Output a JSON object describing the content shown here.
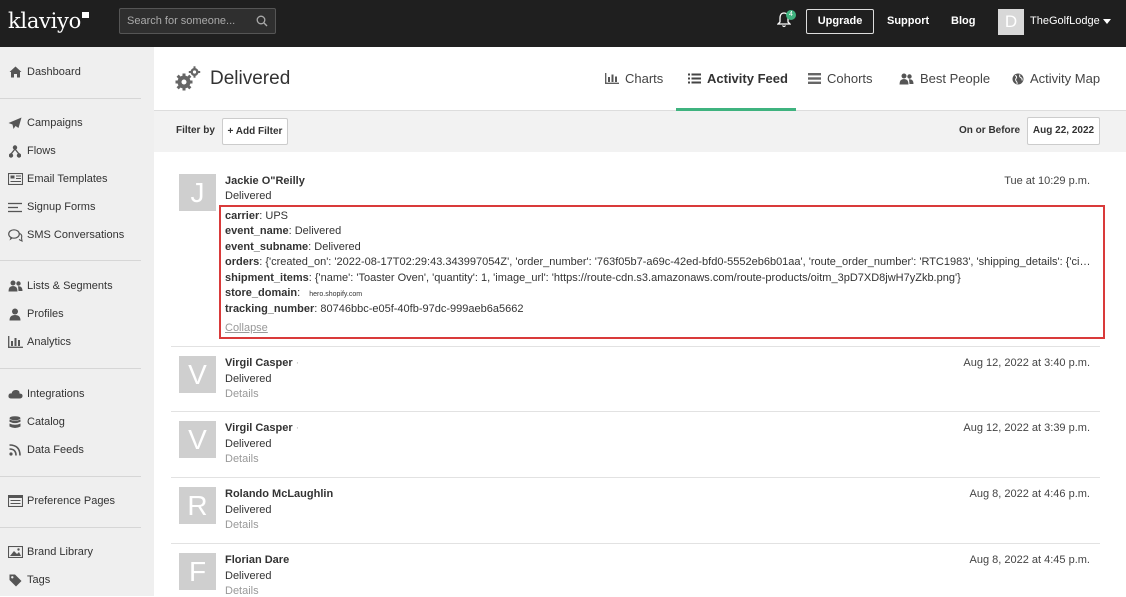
{
  "app": {
    "logo_text": "klaviyo"
  },
  "topbar": {
    "search_placeholder": "Search for someone...",
    "notification_count": "4",
    "upgrade_label": "Upgrade",
    "support_label": "Support",
    "blog_label": "Blog",
    "account_initial": "D",
    "account_name": "TheGolfLodge"
  },
  "sidebar": {
    "items": [
      {
        "label": "Dashboard",
        "icon": "home-icon"
      },
      {
        "label": "Campaigns",
        "icon": "paper-plane-icon"
      },
      {
        "label": "Flows",
        "icon": "flows-icon"
      },
      {
        "label": "Email Templates",
        "icon": "email-template-icon"
      },
      {
        "label": "Signup Forms",
        "icon": "signup-forms-icon"
      },
      {
        "label": "SMS Conversations",
        "icon": "chat-icon"
      },
      {
        "label": "Lists & Segments",
        "icon": "users-icon"
      },
      {
        "label": "Profiles",
        "icon": "user-icon"
      },
      {
        "label": "Analytics",
        "icon": "bar-chart-icon"
      },
      {
        "label": "Integrations",
        "icon": "cloud-icon"
      },
      {
        "label": "Catalog",
        "icon": "database-icon"
      },
      {
        "label": "Data Feeds",
        "icon": "rss-icon"
      },
      {
        "label": "Preference Pages",
        "icon": "preference-page-icon"
      },
      {
        "label": "Brand Library",
        "icon": "image-icon"
      },
      {
        "label": "Tags",
        "icon": "tag-icon"
      }
    ]
  },
  "header": {
    "title": "Delivered",
    "tabs": [
      {
        "label": "Charts",
        "icon": "bar-chart-icon",
        "active": false
      },
      {
        "label": "Activity Feed",
        "icon": "list-icon",
        "active": true
      },
      {
        "label": "Cohorts",
        "icon": "cohorts-icon",
        "active": false
      },
      {
        "label": "Best People",
        "icon": "users-icon",
        "active": false
      },
      {
        "label": "Activity Map",
        "icon": "globe-icon",
        "active": false
      }
    ]
  },
  "filterbar": {
    "filter_by_label": "Filter by",
    "add_filter_label": "+ Add Filter",
    "on_or_before_label": "On or Before",
    "date_value": "Aug 22, 2022"
  },
  "feed": {
    "expanded": {
      "initial": "J",
      "name": "Jackie O\"Reilly",
      "event": "Delivered",
      "time": "Tue at 10:29 p.m.",
      "properties": [
        {
          "key": "carrier",
          "value": "UPS"
        },
        {
          "key": "event_name",
          "value": "Delivered"
        },
        {
          "key": "event_subname",
          "value": "Delivered"
        },
        {
          "key": "orders",
          "value": "{'created_on': '2022-08-17T02:29:43.343997054Z', 'order_number': '763f05b7-a69c-42ed-bfd0-5552eb6b01aa', 'route_order_number': 'RTC1983', 'shipping_details': {'city': '..."
        },
        {
          "key": "shipment_items",
          "value": "{'name': 'Toaster Oven', 'quantity': 1, 'image_url': 'https://route-cdn.s3.amazonaws.com/route-products/oitm_3pD7XD8jwH7yZkb.png'}"
        },
        {
          "key": "store_domain",
          "value": "hero.shopify.com"
        },
        {
          "key": "tracking_number",
          "value": "80746bbc-e05f-40fb-97dc-999aeb6a5662"
        }
      ],
      "collapse_label": "Collapse"
    },
    "items": [
      {
        "initial": "V",
        "name": "Virgil Casper",
        "event": "Delivered",
        "details": "Details",
        "time": "Aug 12, 2022 at 3:40 p.m."
      },
      {
        "initial": "V",
        "name": "Virgil Casper",
        "event": "Delivered",
        "details": "Details",
        "time": "Aug 12, 2022 at 3:39 p.m."
      },
      {
        "initial": "R",
        "name": "Rolando McLaughlin",
        "event": "Delivered",
        "details": "Details",
        "time": "Aug 8, 2022 at 4:46 p.m."
      },
      {
        "initial": "F",
        "name": "Florian Dare",
        "event": "Delivered",
        "details": "Details",
        "time": "Aug 8, 2022 at 4:45 p.m."
      }
    ]
  }
}
